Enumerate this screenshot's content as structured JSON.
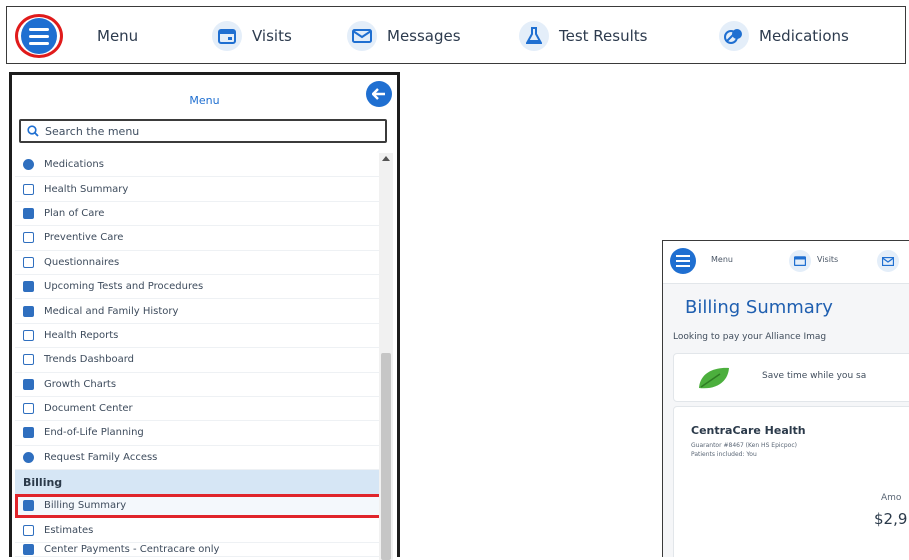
{
  "topbar": {
    "items": [
      {
        "label": "Menu",
        "icon": "hamburger-icon"
      },
      {
        "label": "Visits",
        "icon": "calendar-icon"
      },
      {
        "label": "Messages",
        "icon": "envelope-icon"
      },
      {
        "label": "Test Results",
        "icon": "flask-icon"
      },
      {
        "label": "Medications",
        "icon": "pills-icon"
      }
    ],
    "highlight_color": "#e01b1b",
    "accent_color": "#1f6fd1"
  },
  "menu_panel": {
    "title": "Menu",
    "search_placeholder": "Search the menu",
    "items": [
      {
        "label": "Medications",
        "icon": "pills-icon"
      },
      {
        "label": "Health Summary",
        "icon": "health-summary-icon"
      },
      {
        "label": "Plan of Care",
        "icon": "plan-of-care-icon"
      },
      {
        "label": "Preventive Care",
        "icon": "preventive-care-icon"
      },
      {
        "label": "Questionnaires",
        "icon": "questionnaire-icon"
      },
      {
        "label": "Upcoming Tests and Procedures",
        "icon": "flask-icon"
      },
      {
        "label": "Medical and Family History",
        "icon": "history-icon"
      },
      {
        "label": "Health Reports",
        "icon": "report-icon"
      },
      {
        "label": "Trends Dashboard",
        "icon": "trends-icon"
      },
      {
        "label": "Growth Charts",
        "icon": "growth-chart-icon"
      },
      {
        "label": "Document Center",
        "icon": "document-icon"
      },
      {
        "label": "End-of-Life Planning",
        "icon": "planning-icon"
      },
      {
        "label": "Request Family Access",
        "icon": "family-access-icon"
      }
    ],
    "billing_section": {
      "heading": "Billing",
      "items": [
        {
          "label": "Billing Summary",
          "icon": "billing-card-icon",
          "selected": true
        },
        {
          "label": "Estimates",
          "icon": "estimates-icon"
        },
        {
          "label": "Center Payments - Centracare only",
          "icon": "payments-icon"
        }
      ]
    }
  },
  "billing_preview": {
    "nav": {
      "menu_label": "Menu",
      "visits_label": "Visits"
    },
    "title": "Billing Summary",
    "subtitle": "Looking to pay your Alliance Imag",
    "promo_text": "Save time while you sa",
    "account": {
      "organization": "CentraCare Health",
      "guarantor": "Guarantor #8467 (Ken HS Epicpoc)",
      "patients": "Patients included: You",
      "amount_label": "Amo",
      "amount_value": "$2,9"
    }
  }
}
